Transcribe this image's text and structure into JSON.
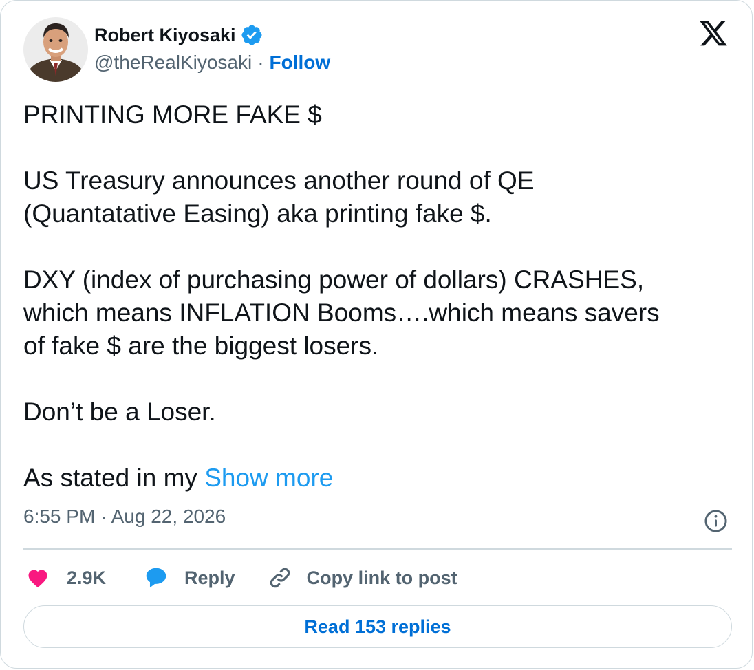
{
  "author": {
    "name": "Robert Kiyosaki",
    "handle": "@theRealKiyosaki",
    "separator": "·",
    "follow_label": "Follow",
    "verified_icon": "verified-badge-icon",
    "avatar_icon": "profile-photo"
  },
  "brand": {
    "logo_icon": "x-logo-icon"
  },
  "post": {
    "paragraphs": [
      "PRINTING MORE FAKE $",
      "US Treasury announces another round of QE\n(Quantatative Easing) aka printing fake $.",
      "DXY (index of purchasing power of dollars) CRASHES,\nwhich means INFLATION Booms….which means savers\nof fake $ are the biggest losers.",
      "Don’t be a Loser."
    ],
    "last_line_prefix": "As stated in my ",
    "show_more_label": "Show more",
    "timestamp": "6:55 PM · Aug 22, 2026"
  },
  "actions": {
    "like_count": "2.9K",
    "reply_label": "Reply",
    "copy_link_label": "Copy link to post",
    "read_replies_label": "Read 153 replies"
  },
  "colors": {
    "text": "#0f1419",
    "secondary_text": "#536471",
    "link_blue": "#006fd6",
    "show_more_blue": "#1d9bf0",
    "verified_blue": "#1d9bf0",
    "like_pink": "#f91880",
    "border": "#cfd9de"
  }
}
